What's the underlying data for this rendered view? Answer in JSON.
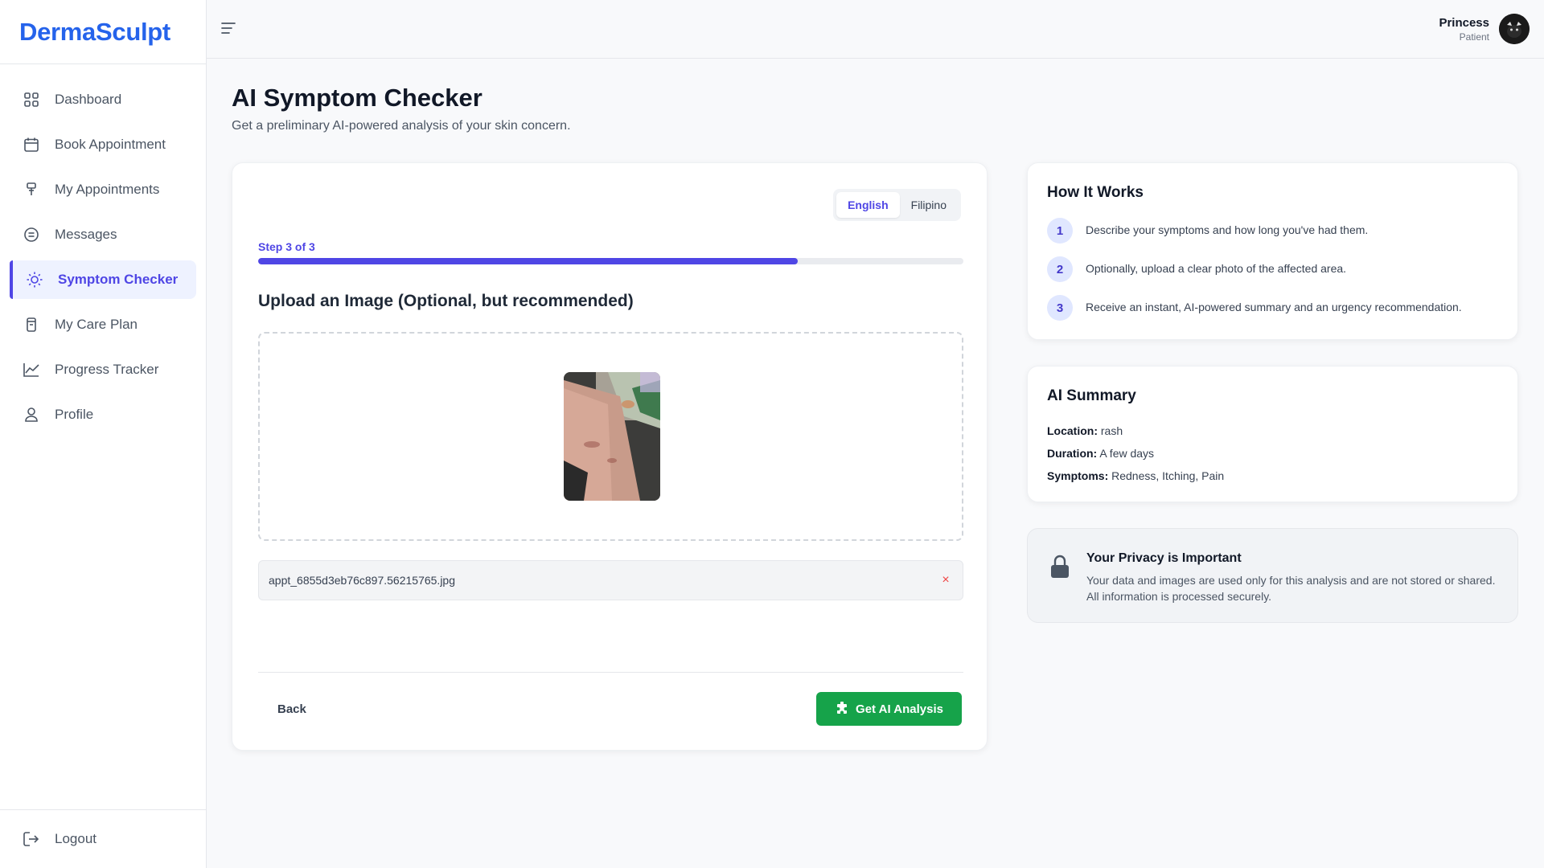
{
  "app": {
    "brand": "DermaSculpt"
  },
  "sidebar": {
    "items": [
      {
        "label": "Dashboard",
        "icon": "dashboard-grid-icon"
      },
      {
        "label": "Book Appointment",
        "icon": "calendar-icon"
      },
      {
        "label": "My Appointments",
        "icon": "appointment-icon"
      },
      {
        "label": "Messages",
        "icon": "message-icon"
      },
      {
        "label": "Symptom Checker",
        "icon": "sun-icon",
        "active": true
      },
      {
        "label": "My Care Plan",
        "icon": "clipboard-icon"
      },
      {
        "label": "Progress Tracker",
        "icon": "line-chart-icon"
      },
      {
        "label": "Profile",
        "icon": "user-icon"
      }
    ],
    "logout_label": "Logout"
  },
  "user": {
    "name": "Princess",
    "role": "Patient"
  },
  "page": {
    "title": "AI Symptom Checker",
    "subtitle": "Get a preliminary AI-powered analysis of your skin concern."
  },
  "wizard": {
    "languages": [
      "English",
      "Filipino"
    ],
    "active_language": "English",
    "step_label": "Step 3 of 3",
    "progress_fraction": 0.765,
    "section_title": "Upload an Image (Optional, but recommended)",
    "file_name": "appt_6855d3eb76c897.56215765.jpg",
    "remove_symbol": "×",
    "back_label": "Back",
    "submit_label": "Get AI Analysis"
  },
  "how_it_works": {
    "title": "How It Works",
    "steps": [
      {
        "num": "1",
        "text": "Describe your symptoms and how long you've had them."
      },
      {
        "num": "2",
        "text": "Optionally, upload a clear photo of the affected area."
      },
      {
        "num": "3",
        "text": "Receive an instant, AI-powered summary and an urgency recommendation."
      }
    ]
  },
  "summary": {
    "title": "AI Summary",
    "location_label": "Location:",
    "location": "rash",
    "duration_label": "Duration:",
    "duration": "A few days",
    "symptoms_label": "Symptoms:",
    "symptoms": "Redness, Itching, Pain"
  },
  "privacy": {
    "title": "Your Privacy is Important",
    "text": "Your data and images are used only for this analysis and are not stored or shared. All information is processed securely."
  },
  "colors": {
    "brand": "#2563eb",
    "accent": "#4f46e5",
    "success": "#16a34a",
    "danger": "#ef4444"
  }
}
